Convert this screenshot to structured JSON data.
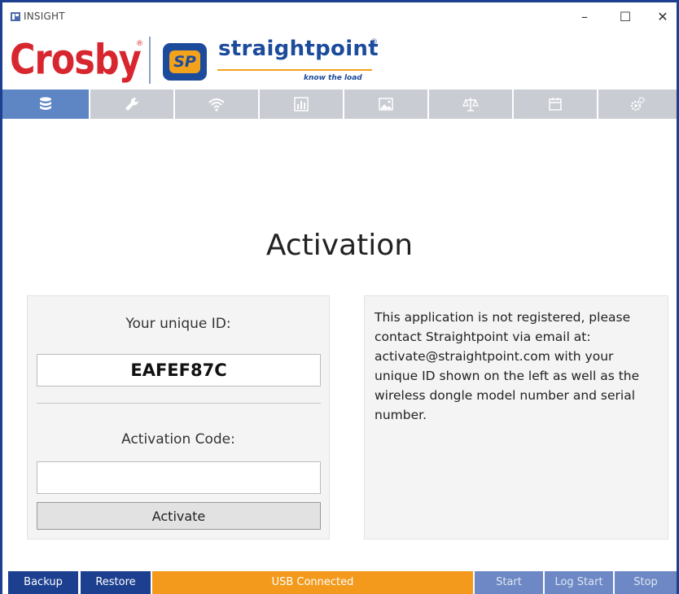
{
  "window": {
    "title": "INSIGHT",
    "minimize": "–",
    "maximize": "☐",
    "close": "✕"
  },
  "logo": {
    "crosby": "Crosby",
    "crosby_reg": "®",
    "sp_badge": "SP",
    "straightpoint": "straightpoint",
    "straightpoint_reg": "®",
    "tagline": "know the load"
  },
  "tabs": [
    {
      "icon": "database-icon",
      "active": true
    },
    {
      "icon": "wrench-icon",
      "active": false
    },
    {
      "icon": "wifi-icon",
      "active": false
    },
    {
      "icon": "bar-chart-icon",
      "active": false
    },
    {
      "icon": "image-icon",
      "active": false
    },
    {
      "icon": "scale-icon",
      "active": false
    },
    {
      "icon": "calendar-icon",
      "active": false
    },
    {
      "icon": "gears-icon",
      "active": false
    }
  ],
  "main": {
    "heading": "Activation",
    "uid_label": "Your unique ID:",
    "uid_value": "EAFEF87C",
    "code_label": "Activation Code:",
    "code_value": "",
    "activate_label": "Activate",
    "info": "This application is not registered, please contact Straightpoint via email at: activate@straightpoint.com with your unique ID shown on the left as well as the wireless dongle model number and serial number."
  },
  "statusbar": {
    "backup": "Backup",
    "restore": "Restore",
    "usb_status": "USB Connected",
    "start": "Start",
    "log_start": "Log Start",
    "stop": "Stop"
  },
  "colors": {
    "frame": "#1c3f8f",
    "tab_active": "#5e85c4",
    "tab_inactive": "#c9ccd3",
    "status_orange": "#f39a1c",
    "crosby_red": "#d7262e",
    "brand_blue": "#1c4b9c",
    "brand_orange": "#f2a21b"
  }
}
